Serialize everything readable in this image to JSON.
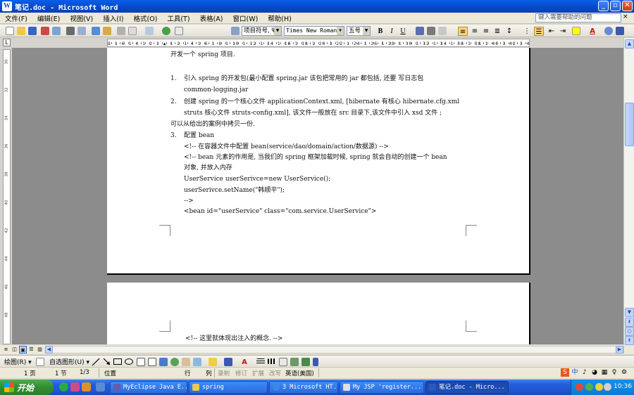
{
  "window": {
    "title": "笔记.doc - Microsoft Word",
    "min_glyph": "_",
    "max_glyph": "▫",
    "close_glyph": "✕"
  },
  "menu": {
    "items": [
      "文件(F)",
      "编辑(E)",
      "视图(V)",
      "插入(I)",
      "格式(O)",
      "工具(T)",
      "表格(A)",
      "窗口(W)",
      "帮助(H)"
    ],
    "help_placeholder": "键入需要帮助的问题",
    "help_close": "×"
  },
  "toolbar": {
    "style": "项目符号, Ψ",
    "font": "Times New Roman",
    "size": "五号",
    "bold": "B",
    "italic": "I",
    "underline": "U",
    "font_color": "A",
    "highlight_color": "#ffff00",
    "accent_color": "#d01010"
  },
  "ruler": {
    "corner": "L",
    "numbers": "8 1 6 1 4 1 2 1 ▲ 1 2 1 4 1 6 1 8 1 10 1 12 1 14 1 16 1 18 1 20 1 22 1 24 1 26 1 28 1 30 1 32 1 34 1 36 1 38 1 40 1 42 1 44 1 46 1 48",
    "vnums": [
      "30",
      "32",
      "34",
      "36",
      "38",
      "40",
      "42",
      "44",
      "46",
      "48"
    ]
  },
  "document": {
    "lines": [
      "开发一个 spring 项目.",
      "1.",
      "引入  spring  的开发包(最小配置  spring.jar  该包把常用的  jar  都包括, 还要  写日志包",
      "common-logging.jar",
      "2.",
      "创建  spring  的一个核心文件   applicationContext.xml,  [hibernate 有核心   hibernate.cfg.xml",
      "struts 核心文件   struts-config.xml],  该文件一般放在 src 目录下,该文件中引入  xsd 文件 ;",
      "可以从给出的案例中拷贝一份.",
      "3.",
      "配置 bean",
      "<!-- 在容器文件中配置 bean(service/dao/domain/action/数据源) -->",
      "<!-- bean 元素的作用是, 当我们的 spring 框架加载时候, spring 就会自动的创建一个 bean",
      "对象,  并放入内存",
      " UserService userSerivce=new UserService();",
      " userSerivce.setName(\"韩顺平\");",
      " -->",
      "<bean id=\"userService\" class=\"com.service.UserService\">"
    ],
    "page2_line": "<!-- 这里就体现出注入的概念. -->"
  },
  "drawing_toolbar": {
    "draw": "绘图(R) ▾",
    "autoshapes": "自选图形(U) ▾"
  },
  "status": {
    "page": "1 页",
    "section": "1 节",
    "pages": "1/3",
    "position": "位置",
    "line": "行",
    "column": "列",
    "record": "录制",
    "revise": "修订",
    "extend": "扩展",
    "overwrite": "改写",
    "language": "英语(美国)"
  },
  "ime": [
    "S",
    "中",
    "♪",
    "◕",
    "▦",
    "♀",
    "⚙"
  ],
  "taskbar": {
    "start": "开始",
    "tasks": [
      "MyEclipse Java E...",
      "spring",
      "3 Microsoft HT...",
      "My JSP 'register...",
      "笔记.doc - Micro..."
    ],
    "clock": "10:36"
  }
}
